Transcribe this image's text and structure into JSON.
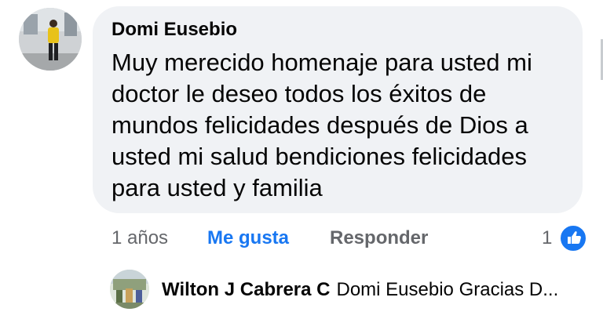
{
  "comment": {
    "author": "Domi Eusebio",
    "text": "Muy merecido homenaje para usted mi doctor le deseo todos los éxitos de mundos felicidades después de Dios a usted mi salud bendiciones felicidades para usted y familia",
    "time": "1 años",
    "like_label": "Me gusta",
    "reply_label": "Responder",
    "reaction_count": "1",
    "reaction_icon": "thumbs-up-icon"
  },
  "reply": {
    "author": "Wilton J Cabrera C",
    "preview": "Domi Eusebio Gracias D..."
  },
  "colors": {
    "accent": "#1877f2",
    "bubble": "#f0f2f5",
    "secondary_text": "#65676b"
  }
}
